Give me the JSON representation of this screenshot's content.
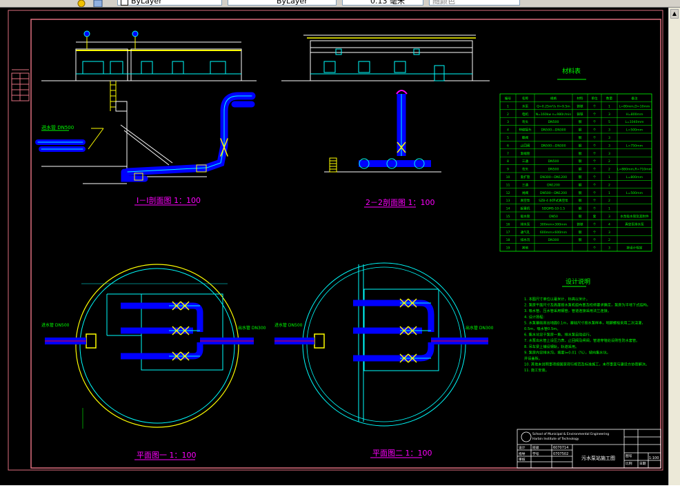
{
  "toolbar": {
    "layer_combo": "ByLayer",
    "linetype_combo": "ByLayer",
    "lineweight_combo": "0.13 毫米",
    "plotstyle_combo": "随颜色"
  },
  "drawing": {
    "section1_title": "I－I剖面图 1：100",
    "section2_title": "2－2剖面图 1：100",
    "plan1_title": "平面图一 1：100",
    "plan2_title": "平面图二 1：100",
    "materials_title": "材料表",
    "notes_title": "设计说明",
    "pipe_label_dn500": "进水管 DN500",
    "pipe_label_dn300": "出水管 DN300",
    "materials_headers": [
      "编号",
      "名称",
      "规格",
      "材料",
      "单位",
      "数量",
      "备注"
    ],
    "materials_rows": [
      [
        "1",
        "水泵",
        "Q=0.25m³/s H=9.5m",
        "铸铁",
        "个",
        "1",
        "L=80mm,D=10mm"
      ],
      [
        "2",
        "电机",
        "N=160kw n=980r/min",
        "铸铁",
        "个",
        "3",
        "H=800mm"
      ],
      [
        "3",
        "弯头",
        "DN500",
        "钢",
        "个",
        "5",
        "L=1040mm"
      ],
      [
        "4",
        "伸缩接头",
        "DN500—DN300",
        "钢",
        "个",
        "3",
        "L=500mm"
      ],
      [
        "5",
        "蝶阀",
        "",
        "钢",
        "个",
        "3",
        ""
      ],
      [
        "6",
        "止回阀",
        "DN500—DN300",
        "钢",
        "个",
        "3",
        "L=750mm"
      ],
      [
        "7",
        "渐缩管",
        "",
        "钢",
        "个",
        "3",
        ""
      ],
      [
        "8",
        "三通",
        "DN500",
        "钢",
        "个",
        "2",
        ""
      ],
      [
        "9",
        "弯头",
        "DN500",
        "钢",
        "个",
        "2",
        "L=880mm,R=710mm"
      ],
      [
        "10",
        "渐扩管",
        "DN300—DN1200",
        "钢",
        "个",
        "1",
        "L=800mm"
      ],
      [
        "11",
        "三通",
        "DN1200",
        "钢",
        "个",
        "2",
        ""
      ],
      [
        "12",
        "闸阀",
        "DN500—DN1200",
        "钢",
        "个",
        "1",
        "L=500mm"
      ],
      [
        "13",
        "真空泵",
        "SZB-4 水环式真空泵",
        "钢",
        "个",
        "2",
        ""
      ],
      [
        "14",
        "起重机",
        "SDQMS-10-1.5",
        "钢",
        "个",
        "1",
        ""
      ],
      [
        "15",
        "吸水管",
        "DN50",
        "钢",
        "套",
        "3",
        "水泵吸水管及其附件"
      ],
      [
        "16",
        "排水泵",
        "300mm×300mm",
        "铸铁",
        "个",
        "4",
        "真空泵排水泵"
      ],
      [
        "17",
        "通气孔",
        "600mm×600mm",
        "钢",
        "个",
        "3",
        ""
      ],
      [
        "18",
        "排水沟",
        "DN300",
        "钢",
        "个",
        "2",
        ""
      ],
      [
        "19",
        "其他",
        "",
        "",
        "个",
        "3",
        "按设计规定"
      ]
    ],
    "notes_lines": [
      "1. 本图尺寸单位以毫米计，标高以米计。",
      "2. 泵房平面尺寸及高度按水泵机组布置及检修要求确定，泵房为半地下式结构。",
      "3. 吸水管、压水管采用钢管，管道连接采用法兰连接。",
      "4. 设计扬程：",
      "5. 水泵基础高出地面0.1m，基础尺寸按水泵样本，地脚螺栓采用二次浇灌，",
      "   0.5m，吸水管0.5m。",
      "6. 集水坑设于泵房一角，排水泵自动运行。",
      "7. 水泵出水管上设压力表、止回阀及闸阀，管道穿墙处设刚性防水套管。",
      "8. 吊车梁上铺设钢轨，轨道采用。",
      "9. 泵房内设排水沟，坡度i=0.01（%），坡向集水坑，",
      "   并设盖板。",
      "10. 其他未说明事项按国家现行规范及标准施工，未尽事宜与建设方协商解决。",
      "11. 施工安装。"
    ],
    "title_block": {
      "school_en": "School of Municipal & Environmental Engineering",
      "school_en2": "Harbin Institute of Technology",
      "drawing_name": "污水泵站施工图",
      "student_id": "6070714",
      "class": "0707502",
      "scale": "1:100",
      "labels": [
        "设计",
        "指导",
        "审核",
        "班级",
        "学号",
        "图号",
        "比例",
        "日期"
      ]
    }
  }
}
